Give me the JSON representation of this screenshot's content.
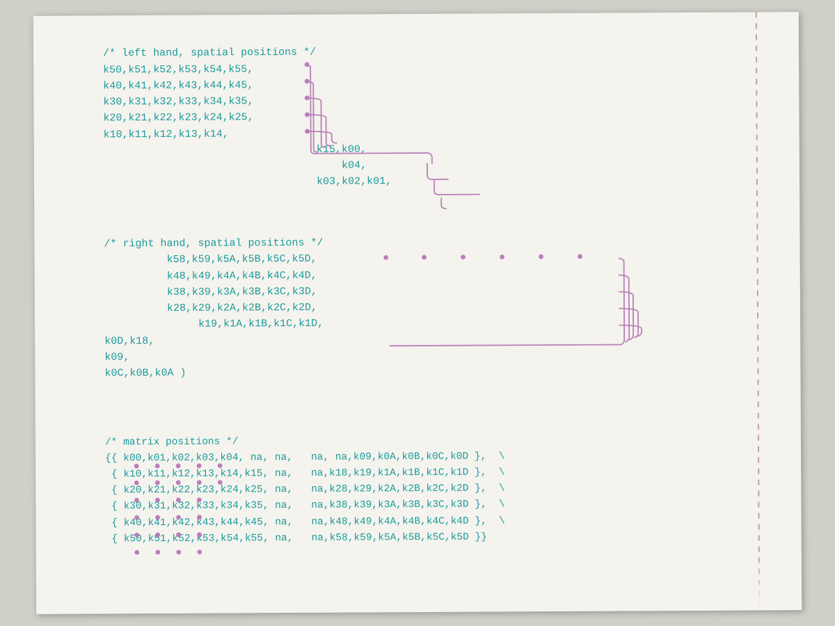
{
  "page": {
    "background_color": "#f5f3ee",
    "code_color": "#1a9b9b",
    "annotation_color": "#b06ab3"
  },
  "left_hand_comment": "/* left hand, spatial positions */",
  "left_hand_rows": [
    "k50,k51,k52,k53,k54,k55,",
    "k40,k41,k42,k43,k44,k45,",
    "k30,k31,k32,k33,k34,k35,",
    "k20,k21,k22,k23,k24,k25,",
    "k10,k11,k12,k13,k14,"
  ],
  "left_hand_continuation": [
    "                              k15,k00,",
    "                                  k04,",
    "                              k03,k02,k01,"
  ],
  "right_hand_comment": "/* right hand, spatial positions */",
  "right_hand_rows": [
    "        k58,k59,k5A,k5B,k5C,k5D,",
    "        k48,k49,k4A,k4B,k4C,k4D,",
    "        k38,k39,k3A,k3B,k3C,k3D,",
    "        k28,k29,k2A,k2B,k2C,k2D,",
    "             k19,k1A,k1B,k1C,k1D,"
  ],
  "right_hand_continuation": [
    "k0D,k18,",
    "k09,",
    "k0C,k0B,k0A )"
  ],
  "matrix_comment": "/* matrix positions */",
  "matrix_rows": [
    "{{ k00,k01,k02,k03,k04, na, na,   na, na,k09,k0A,k0B,k0C,k0D },",
    " { k10,k11,k12,k13,k14,k15, na,   na,k18,k19,k1A,k1B,k1C,k1D },",
    " { k20,k21,k22,k23,k24,k25, na,   na,k28,k29,k2A,k2B,k2C,k2D },",
    " { k30,k31,k32,k33,k34,k35, na,   na,k38,k39,k3A,k3B,k3C,k3D },",
    " { k40,k41,k42,k43,k44,k45, na,   na,k48,k49,k4A,k4B,k4C,k4D },",
    " { k50,k51,k52,k53,k54,k55, na,   na,k58,k59,k5A,k5B,k5C,k5D }}"
  ]
}
